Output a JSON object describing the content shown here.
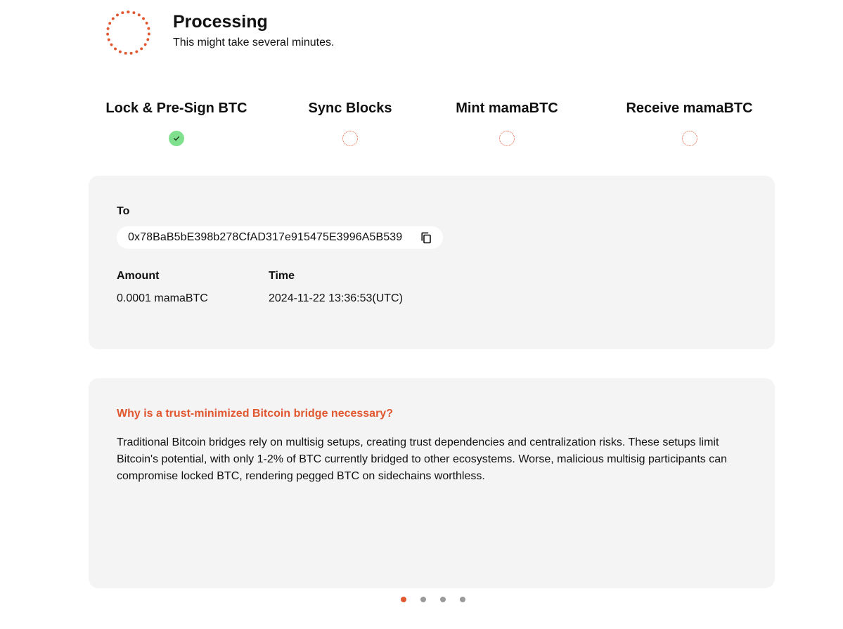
{
  "header": {
    "title": "Processing",
    "subtitle": "This might take several minutes."
  },
  "steps": [
    {
      "label": "Lock & Pre-Sign BTC",
      "status": "done"
    },
    {
      "label": "Sync Blocks",
      "status": "pending"
    },
    {
      "label": "Mint mamaBTC",
      "status": "pending"
    },
    {
      "label": "Receive mamaBTC",
      "status": "pending"
    }
  ],
  "details": {
    "to_label": "To",
    "to_address": "0x78BaB5bE398b278CfAD317e915475E3996A5B539",
    "amount_label": "Amount",
    "amount_value": "0.0001 mamaBTC",
    "time_label": "Time",
    "time_value": "2024-11-22 13:36:53(UTC)"
  },
  "faq": {
    "question": "Why is a trust-minimized Bitcoin bridge necessary?",
    "answer": "Traditional Bitcoin bridges rely on multisig setups, creating trust dependencies and centralization risks. These setups limit Bitcoin's potential, with only 1-2% of BTC currently bridged to other ecosystems. Worse, malicious multisig participants can compromise locked BTC, rendering pegged BTC on sidechains worthless."
  },
  "carousel": {
    "total": 4,
    "active_index": 0
  },
  "colors": {
    "accent": "#e1572f",
    "success": "#7fe08e",
    "card_bg": "#f4f4f4",
    "dot_inactive": "#9a9a9a"
  },
  "icons": {
    "spinner": "loading-spinner-icon",
    "done": "check-icon",
    "pending": "pending-circle-icon",
    "copy": "copy-icon"
  }
}
